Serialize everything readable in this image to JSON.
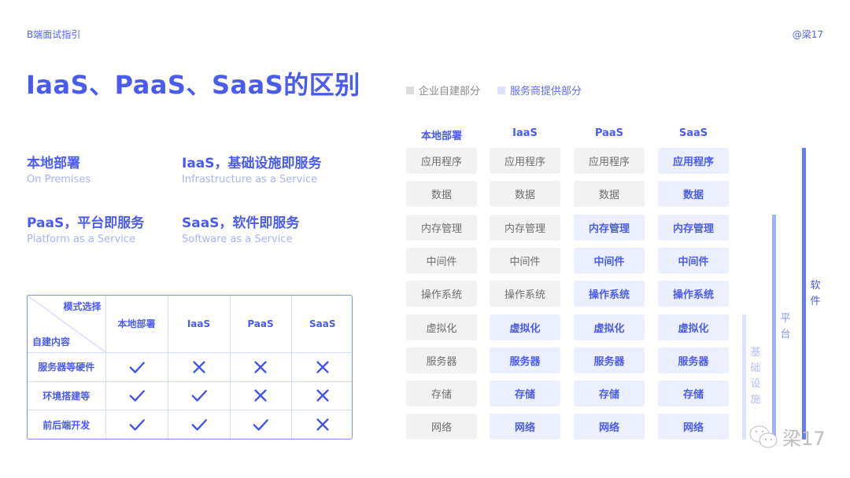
{
  "header": {
    "brand": "B端面试指引",
    "author": "@梁17",
    "title": "IaaS、PaaS、SaaS的区别"
  },
  "legend": [
    {
      "label": "企业自建部分",
      "color": "#dcdcdc"
    },
    {
      "label": "服务商提供部分",
      "color": "#dce2ff"
    }
  ],
  "definitions": [
    {
      "cn": "本地部署",
      "en": "On Premises"
    },
    {
      "cn": "IaaS，基础设施即服务",
      "en": "Infrastructure as a Service"
    },
    {
      "cn": "PaaS，平台即服务",
      "en": "Platform as a Service"
    },
    {
      "cn": "SaaS，软件即服务",
      "en": "Software as a Service"
    }
  ],
  "comparison_table": {
    "corner_top": "模式选择",
    "corner_bottom": "自建内容",
    "columns": [
      "本地部署",
      "IaaS",
      "PaaS",
      "SaaS"
    ],
    "rows": [
      {
        "label": "服务器等硬件",
        "values": [
          "check",
          "cross",
          "cross",
          "cross"
        ]
      },
      {
        "label": "环境搭建等",
        "values": [
          "check",
          "check",
          "cross",
          "cross"
        ]
      },
      {
        "label": "前后端开发",
        "values": [
          "check",
          "check",
          "check",
          "cross"
        ]
      }
    ]
  },
  "stack": {
    "columns": [
      "本地部署",
      "IaaS",
      "PaaS",
      "SaaS"
    ],
    "layers": [
      "应用程序",
      "数据",
      "内存管理",
      "中间件",
      "操作系统",
      "虚拟化",
      "服务器",
      "存储",
      "网络"
    ],
    "provider_from_layer_index": [
      9,
      5,
      2,
      0
    ]
  },
  "tiers": [
    {
      "label": "基础设施",
      "layers_covered": 4,
      "color": "#dce2ff",
      "text_color": "#b3bdf8"
    },
    {
      "label": "平台",
      "layers_covered": 7,
      "color": "#a3b0fb",
      "text_color": "#8494f7"
    },
    {
      "label": "软件",
      "layers_covered": 9,
      "color": "#6479f6",
      "text_color": "#4a5cf0"
    }
  ],
  "watermark": {
    "icon": "wechat-icon",
    "text": "梁17"
  }
}
